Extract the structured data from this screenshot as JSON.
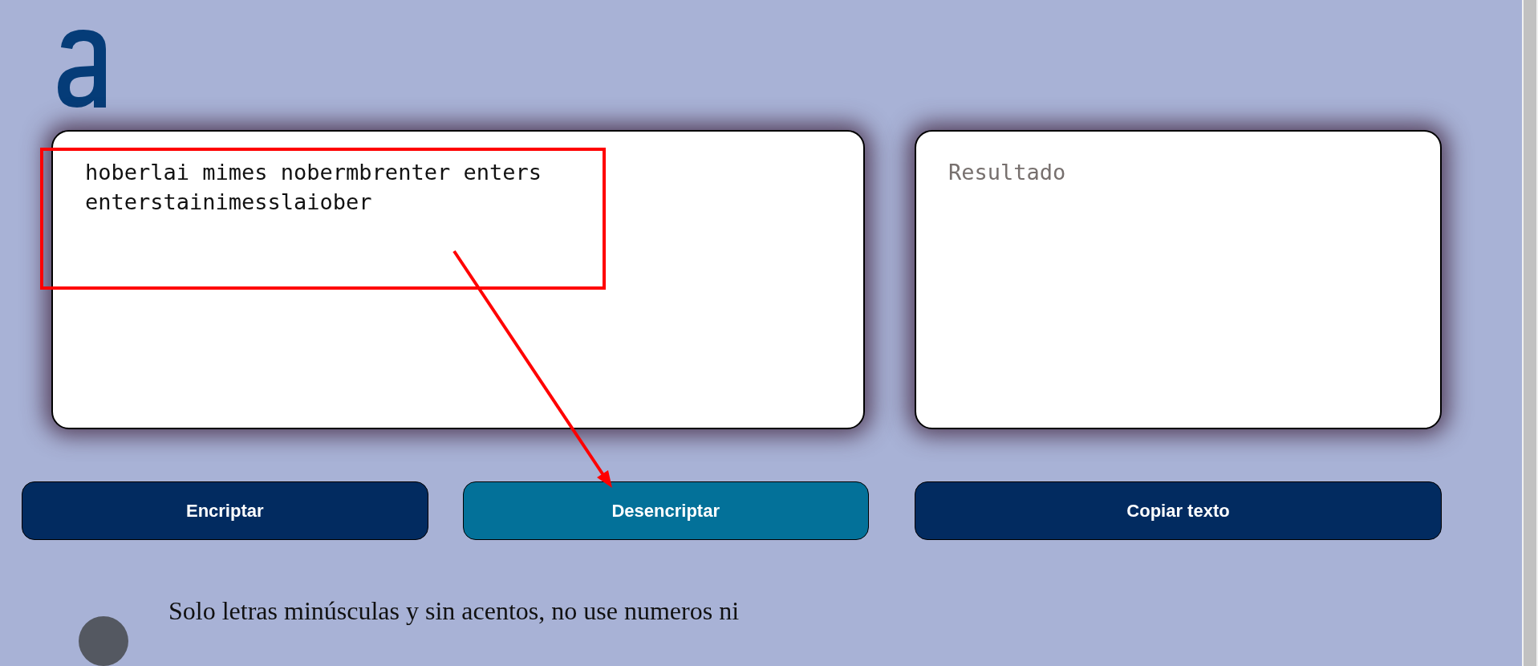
{
  "input": {
    "value": "hoberlai mimes nobermbrenter enters enterstainimesslaiober"
  },
  "output": {
    "placeholder": "Resultado"
  },
  "buttons": [
    {
      "label": "Encriptar",
      "selected": false
    },
    {
      "label": "Desencriptar",
      "selected": true
    }
  ],
  "copy_button": {
    "label": "Copiar texto"
  },
  "notice": {
    "text": "Solo letras minúsculas y sin acentos, no use numeros ni"
  }
}
